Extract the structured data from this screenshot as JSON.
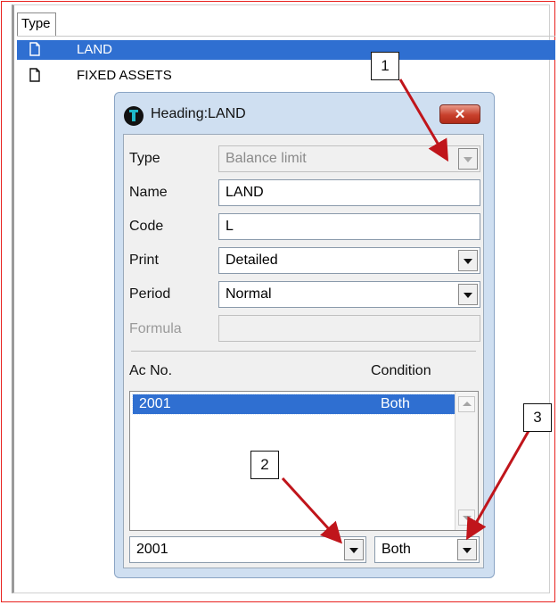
{
  "list": {
    "column_header": "Type",
    "rows": [
      {
        "label": "LAND",
        "icon": "document-icon",
        "selected": true
      },
      {
        "label": "FIXED ASSETS",
        "icon": "document-icon",
        "selected": false
      }
    ]
  },
  "dialog": {
    "title": "Heading:LAND",
    "close_label": "✕",
    "fields": {
      "type": {
        "label": "Type",
        "value": "Balance limit",
        "disabled": true
      },
      "name": {
        "label": "Name",
        "value": "LAND"
      },
      "code": {
        "label": "Code",
        "value": "L"
      },
      "print": {
        "label": "Print",
        "value": "Detailed"
      },
      "period": {
        "label": "Period",
        "value": "Normal"
      },
      "formula": {
        "label": "Formula",
        "value": "",
        "disabled": true
      }
    },
    "accounts": {
      "col_acno": "Ac No.",
      "col_condition": "Condition",
      "rows": [
        {
          "acno": "2001",
          "condition": "Both"
        }
      ],
      "acno_select": "2001",
      "condition_select": "Both"
    }
  },
  "annotations": {
    "callout1": "1",
    "callout2": "2",
    "callout3": "3",
    "arrow_color": "#c0151b"
  }
}
